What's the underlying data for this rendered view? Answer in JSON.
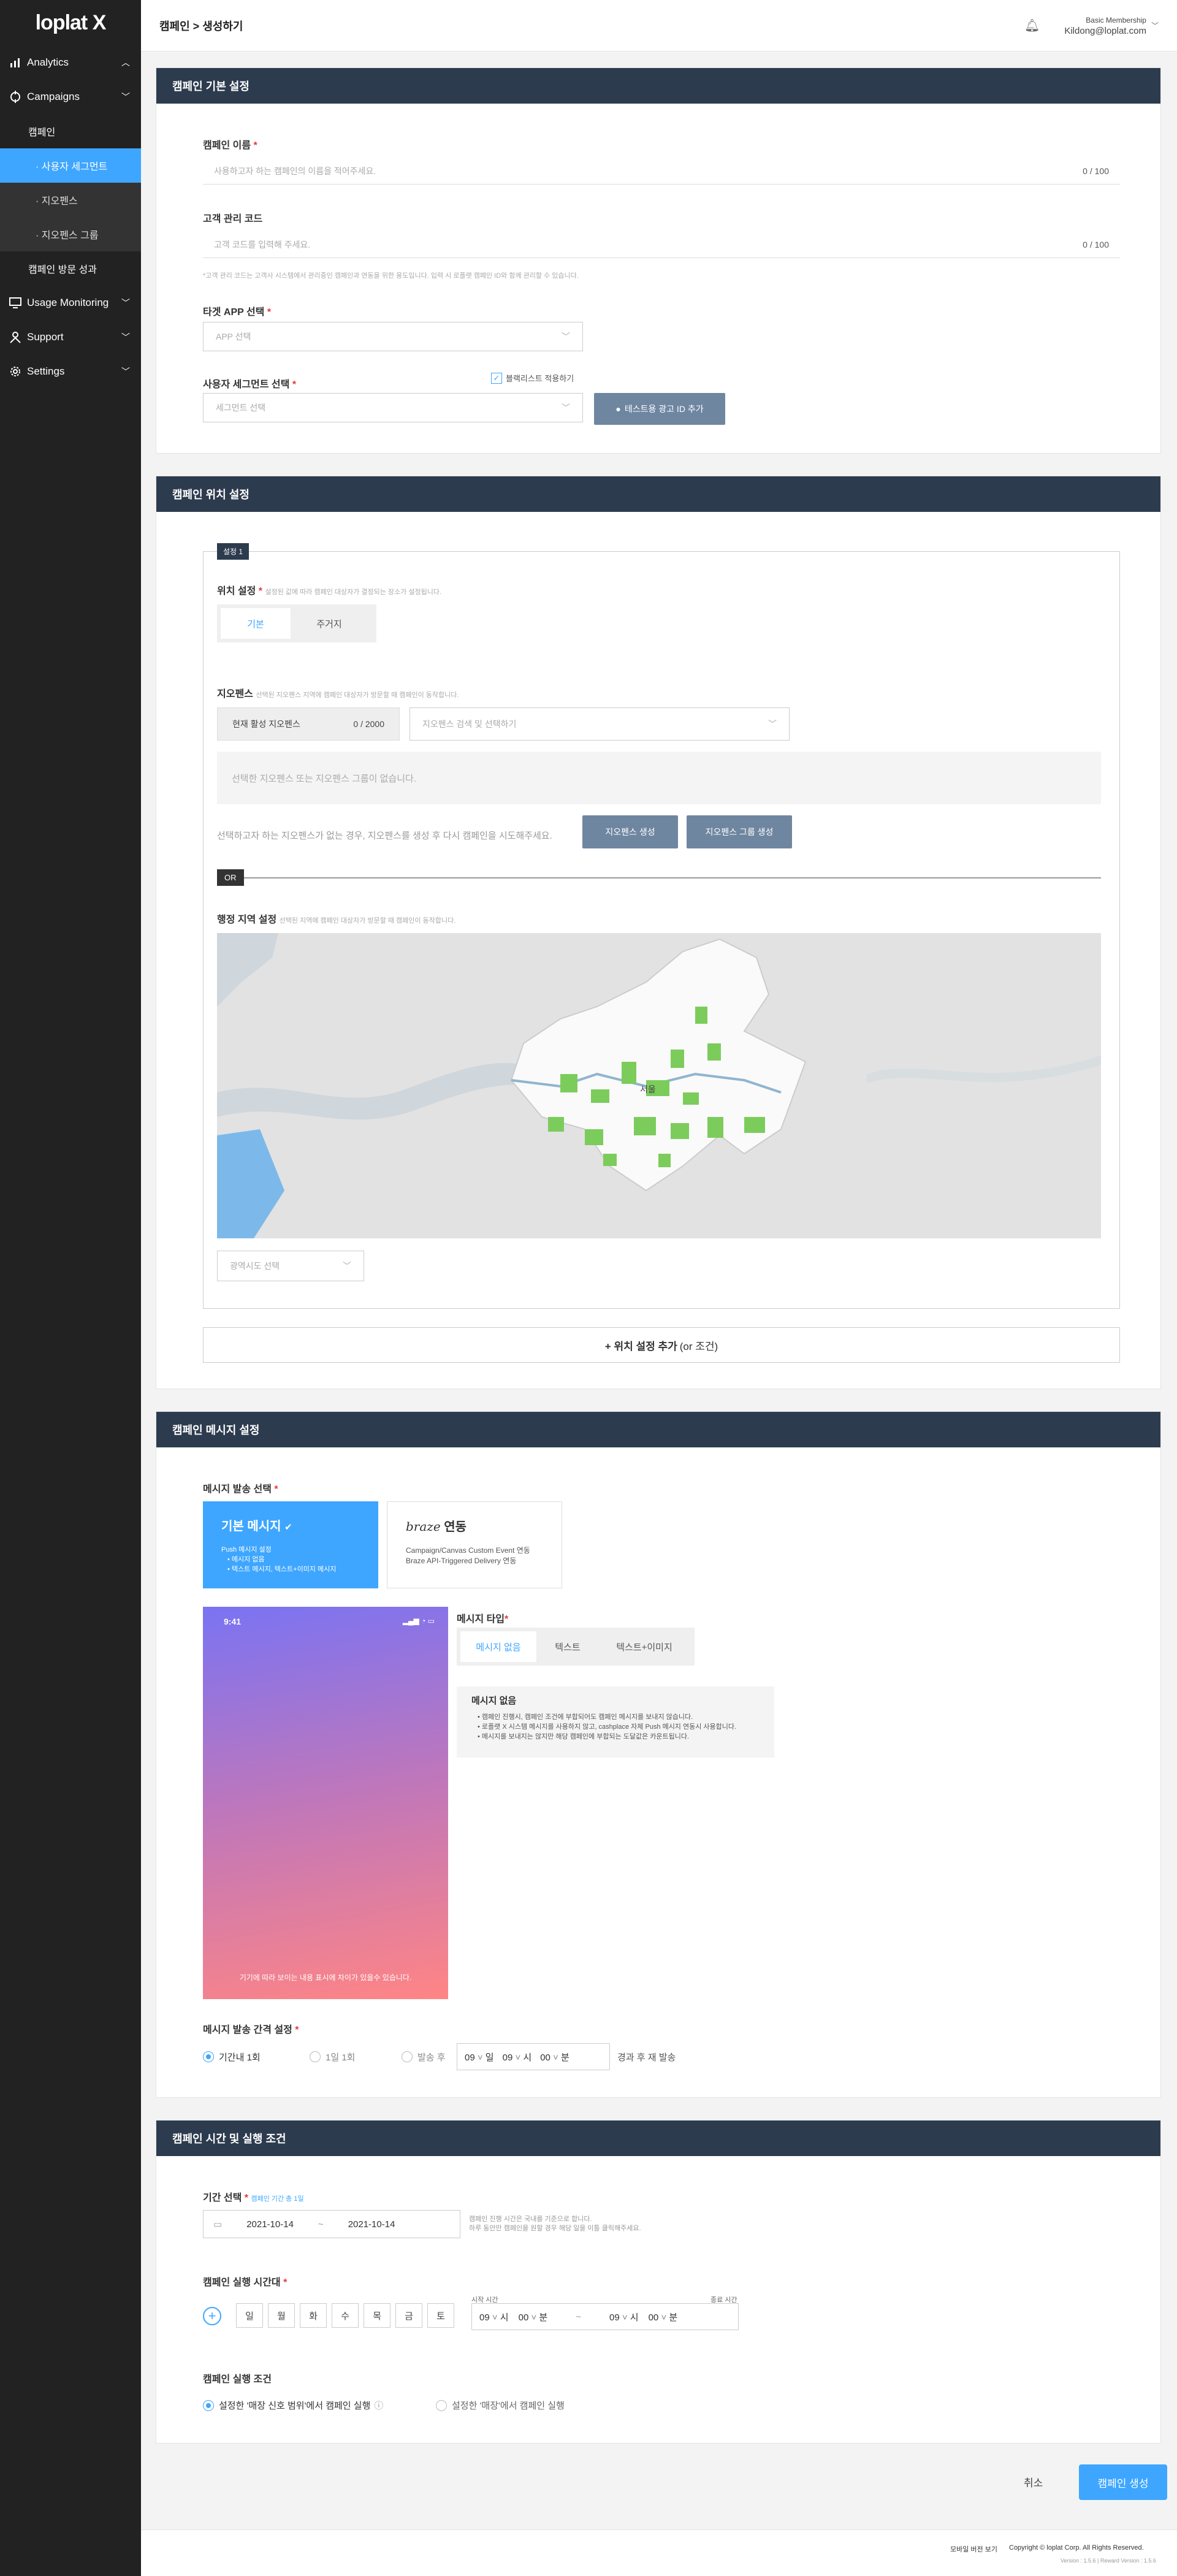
{
  "brand": {
    "logo": "loplat X"
  },
  "sidebar": {
    "analytics": "Analytics",
    "campaigns": "Campaigns",
    "campaign": "캠페인",
    "user_segment": "· 사용자 세그먼트",
    "geofence": "· 지오펜스",
    "geofence_group": "· 지오펜스 그룹",
    "campaign_visit": "캠페인 방문 성과",
    "usage": "Usage Monitoring",
    "support": "Support",
    "settings": "Settings"
  },
  "header": {
    "breadcrumb": "캠페인 > 생성하기",
    "membership": "Basic Membership",
    "email": "Kildong@loplat.com"
  },
  "basic": {
    "title": "캠페인 기본 설정",
    "name_label": "캠페인 이름",
    "name_placeholder": "사용하고자 하는 캠페인의 이름을 적어주세요.",
    "name_count": "0 / 100",
    "code_label": "고객 관리 코드",
    "code_placeholder": "고객 코드를 입력해 주세요.",
    "code_count": "0 / 100",
    "code_hint": "*고객 관리 코드는 고객사 시스템에서 관리중인 캠페인과 연동을 위한 용도입니다. 입력 시 로플랫 캠페인 ID와 함께 관리할 수 있습니다.",
    "app_label": "타겟 APP 선택",
    "app_placeholder": "APP 선택",
    "seg_label": "사용자 세그먼트 선택",
    "blacklist": "블랙리스트 적용하기",
    "seg_placeholder": "세그먼트 선택",
    "test_btn": "테스트용 광고 ID 추가"
  },
  "location": {
    "title": "캠페인 위치 설정",
    "setting_tag": "설정 1",
    "loc_label": "위치 설정",
    "loc_hint": "설정된 값에 따라 캠페인 대상자가 결정되는 장소가 설정됩니다.",
    "tab_basic": "기본",
    "tab_home": "주거지",
    "geo_label": "지오펜스",
    "geo_hint": "선택된 지오펜스 지역에 캠페인 대상자가 방문할 때 캠페인이 동작합니다.",
    "active_geo": "현재 활성 지오펜스",
    "active_count": "0 / 2000",
    "geo_search": "지오펜스 검색 및 선택하기",
    "empty": "선택한 지오펜스 또는 지오펜스 그룹이 없습니다.",
    "create_hint": "선택하고자 하는 지오펜스가 없는 경우, 지오펜스를 생성 후 다시 캠페인을 시도해주세요.",
    "create_geo": "지오펜스 생성",
    "create_group": "지오펜스 그룹 생성",
    "or": "OR",
    "admin_label": "행정 지역 설정",
    "admin_hint": "선택된 지역에 캠페인 대상자가 방문할 때 캠페인이 동작합니다.",
    "map_city": "서울",
    "region_select": "광역시도 선택",
    "add_location": "+ 위치 설정 추가",
    "add_location_or": "(or 조건)"
  },
  "message": {
    "title": "캠페인 메시지 설정",
    "send_label": "메시지 발송 선택",
    "basic_title": "기본 메시지",
    "basic_desc1": "Push 메시지 설정",
    "basic_desc2": "• 메시지 없음",
    "basic_desc3": "• 텍스트 메시지, 텍스트+이미지 메시지",
    "braze_logo": "braze",
    "braze_title": "연동",
    "braze_desc1": "Campaign/Canvas Custom Event 연동",
    "braze_desc2": "Braze API-Triggered Delivery 연동",
    "phone_time": "9:41",
    "phone_text": "기기에 따라 보이는 내용 표시에 차이가 있을수 있습니다.",
    "type_label": "메시지 타입",
    "type_none": "메시지 없음",
    "type_text": "텍스트",
    "type_img": "텍스트+이미지",
    "none_title": "메시지 없음",
    "none_b1": "• 캠페인 진행시, 캠페인 조건에 부합되어도 캠페인 메시지를 보내지 않습니다.",
    "none_b2": "• 로플랫 X 시스템 메시지를 사용하지 않고, cashplace 자체 Push 메시지 연동시 사용합니다.",
    "none_b3": "• 메시지를 보내지는 않지만 해당 캠페인에 부합되는 도달값은 카운트됩니다.",
    "interval_label": "메시지 발송 간격 설정",
    "opt1": "기간내 1회",
    "opt2": "1일 1회",
    "opt3": "발송 후",
    "day_val": "09",
    "day_unit": "일",
    "hour_val": "09",
    "hour_unit": "시",
    "min_val": "00",
    "min_unit": "분",
    "resend": "경과 후 재 발송"
  },
  "schedule": {
    "title": "캠페인 시간 및 실행 조건",
    "period_label": "기간 선택",
    "period_hint": "캠페인 기간 총 1일",
    "start_date": "2021-10-14",
    "end_date": "2021-10-14",
    "date_sep": "~",
    "date_note1": "캠페인 진행 시간은 국내를 기준으로 합니다.",
    "date_note2": "하루 동안만 캠페인을 원할 경우 해당 일을 이틀 클릭해주세요.",
    "time_label": "캠페인 실행 시간대",
    "days": [
      "일",
      "월",
      "화",
      "수",
      "목",
      "금",
      "토"
    ],
    "start_time_label": "시작 시간",
    "end_time_label": "종료 시간",
    "start_h": "09",
    "start_m": "00",
    "end_h": "09",
    "end_m": "00",
    "h_unit": "시",
    "m_unit": "분",
    "time_sep": "~",
    "cond_label": "캠페인 실행 조건",
    "cond1": "설정한 '매장 신호 범위'에서 캠페인 실행",
    "cond2": "설정한 '매장'에서 캠페인 실행"
  },
  "footer": {
    "cancel": "취소",
    "create": "캠페인 생성",
    "mobile": "모바일 버전 보기",
    "copyright": "Copyright © loplat Corp. All Rights Reserved.",
    "version": "Version : 1.5.6 | Reward Version : 1.5.6"
  },
  "colors": {
    "accent": "#3ea6ff",
    "header": "#2d3b4e",
    "sidebar": "#222222"
  }
}
